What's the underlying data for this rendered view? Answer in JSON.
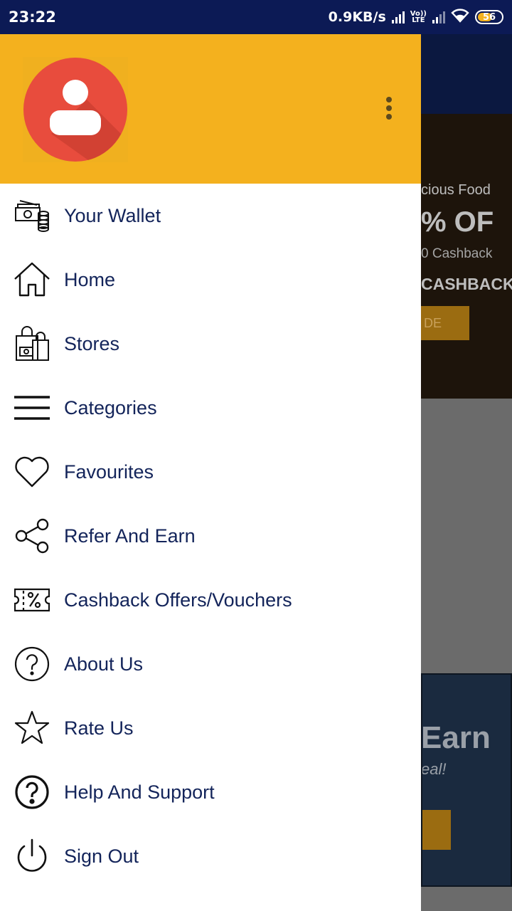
{
  "status_bar": {
    "time": "23:22",
    "net_speed": "0.9KB/s",
    "volte_top": "Vo))",
    "volte_bottom": "LTE",
    "battery": "56"
  },
  "background_page": {
    "banner_line1": "cious Food",
    "banner_line2": "% OF",
    "banner_line3": "0 Cashback",
    "banner_line4": "CASHBACK",
    "banner_button": "DE",
    "promo_title": "Earn",
    "promo_subtitle": "eal!"
  },
  "drawer": {
    "header_color": "#f4b11e",
    "items": [
      {
        "label": "Your Wallet",
        "icon": "wallet-icon"
      },
      {
        "label": "Home",
        "icon": "home-icon"
      },
      {
        "label": "Stores",
        "icon": "stores-icon"
      },
      {
        "label": "Categories",
        "icon": "categories-icon"
      },
      {
        "label": "Favourites",
        "icon": "heart-icon"
      },
      {
        "label": "Refer And Earn",
        "icon": "share-icon"
      },
      {
        "label": "Cashback Offers/Vouchers",
        "icon": "voucher-icon"
      },
      {
        "label": "About Us",
        "icon": "question-circle-icon"
      },
      {
        "label": "Rate Us",
        "icon": "star-icon"
      },
      {
        "label": "Help And Support",
        "icon": "help-icon"
      },
      {
        "label": "Sign Out",
        "icon": "power-icon"
      }
    ]
  },
  "colors": {
    "status_bar": "#0c1a55",
    "menu_text": "#13245a",
    "avatar_red": "#e84c3d"
  }
}
